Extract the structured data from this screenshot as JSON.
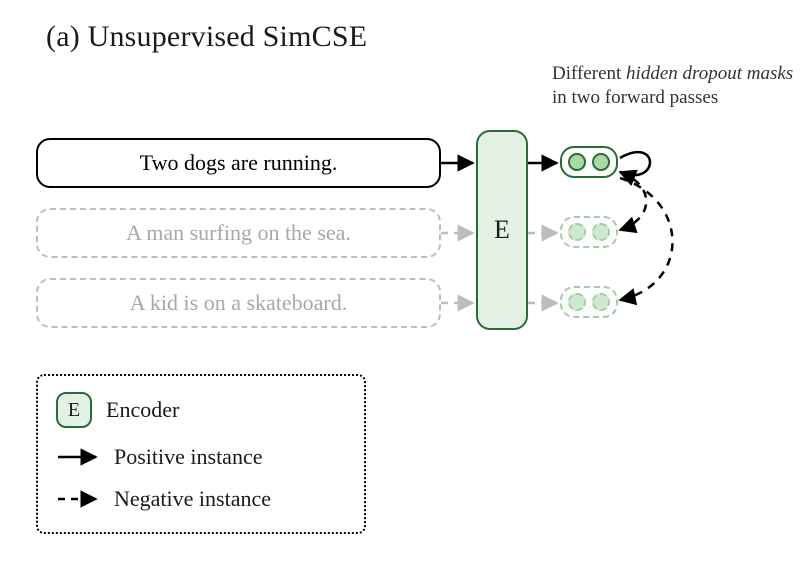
{
  "title": "(a) Unsupervised SimCSE",
  "caption": {
    "line1_plain": "Different ",
    "line1_em": "hidden dropout masks",
    "line2": "in two forward passes"
  },
  "sentences": {
    "s1": "Two dogs are running.",
    "s2": "A man surfing on the sea.",
    "s3": "A kid is on a skateboard."
  },
  "encoder_label": "E",
  "legend": {
    "encoder_icon": "E",
    "encoder_label": "Encoder",
    "positive_label": "Positive instance",
    "negative_label": "Negative instance"
  }
}
